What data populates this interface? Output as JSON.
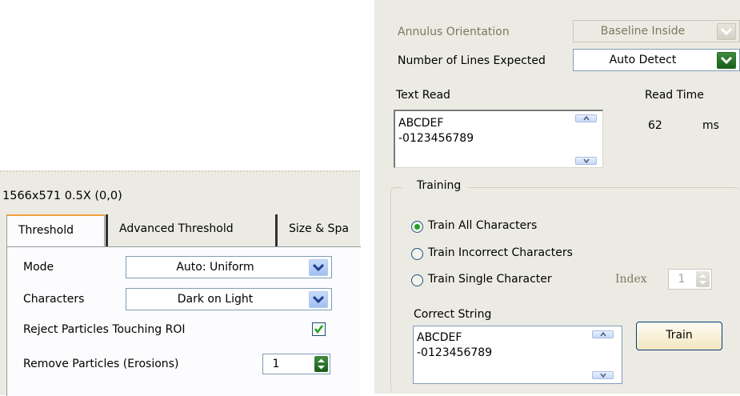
{
  "left_panel": {
    "status_text": "1566x571 0.5X   (0,0)",
    "tabs": [
      {
        "label": "Threshold",
        "active": true
      },
      {
        "label": "Advanced Threshold",
        "active": false
      },
      {
        "label": "Size & Spa",
        "active": false
      }
    ],
    "mode": {
      "label": "Mode",
      "value": "Auto: Uniform"
    },
    "characters": {
      "label": "Characters",
      "value": "Dark on Light"
    },
    "reject_particles": {
      "label": "Reject Particles Touching ROI",
      "checked": true
    },
    "remove_particles": {
      "label": "Remove Particles (Erosions)",
      "value": "1"
    }
  },
  "right_panel": {
    "annulus_orientation": {
      "label": "Annulus Orientation",
      "value": "Baseline Inside",
      "enabled": false
    },
    "lines_expected": {
      "label": "Number of Lines Expected",
      "value": "Auto Detect"
    },
    "text_read": {
      "label": "Text Read",
      "lines": [
        "ABCDEF",
        "-0123456789"
      ]
    },
    "read_time": {
      "label": "Read Time",
      "value": "62",
      "unit": "ms"
    },
    "training": {
      "title": "Training",
      "options": [
        {
          "label": "Train All Characters",
          "selected": true
        },
        {
          "label": "Train Incorrect Characters",
          "selected": false
        },
        {
          "label": "Train Single Character",
          "selected": false
        }
      ],
      "index": {
        "label": "Index",
        "value": "1",
        "enabled": false
      },
      "correct_string": {
        "label": "Correct String",
        "lines": [
          "ABCDEF",
          "-0123456789"
        ]
      },
      "train_button": "Train"
    }
  },
  "colors": {
    "panel_bg": "#ecebe3",
    "accent_green": "#21a121",
    "tab_highlight": "#f0a03c",
    "input_border": "#7f9db9"
  }
}
